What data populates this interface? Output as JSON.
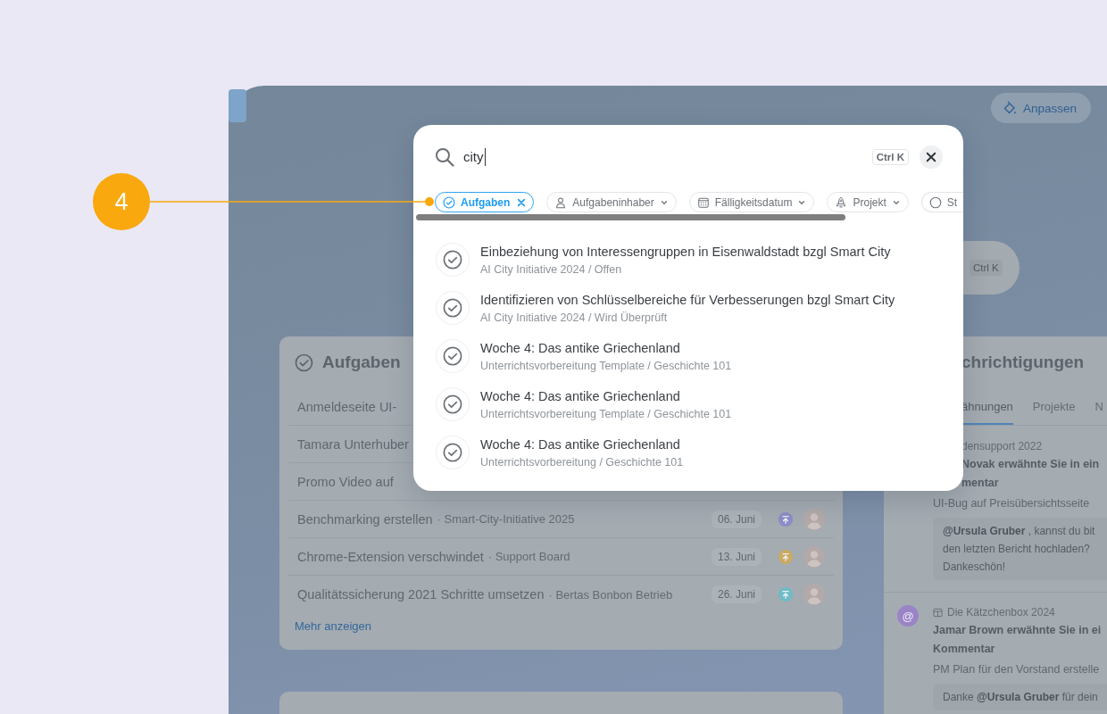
{
  "callout": {
    "number": "4"
  },
  "dashboard": {
    "customize_button": {
      "label": "Anpassen"
    },
    "search_bar": {
      "shortcut": "Ctrl K"
    },
    "tasks_card": {
      "title": "Aufgaben",
      "rows": [
        {
          "title": "Anmeldeseite UI-"
        },
        {
          "title": "Tamara Unterhuber"
        },
        {
          "title": "Promo Video auf"
        },
        {
          "title": "Benchmarking erstellen",
          "project": "· Smart-City-Initiative 2025",
          "due": "06. Juni",
          "color": "#8e8cc9",
          "assignee_photo": true
        },
        {
          "title": "Chrome-Extension verschwindet",
          "project": "· Support Board",
          "due": "13. Juni",
          "color": "#c9ab63",
          "assignee_photo": true
        },
        {
          "title": "Qualitätssicherung 2021 Schritte umsetzen",
          "project": "· Bertas Bonbon Betrieb",
          "due": "26. Juni",
          "color": "#6dbcc7",
          "assignee_photo": true
        }
      ],
      "more_link": "Mehr anzeigen"
    },
    "notifications_card": {
      "title": "chrichtigungen",
      "tabs": [
        {
          "label": "ähnungen",
          "selected": true
        },
        {
          "label": "Projekte",
          "selected": false
        },
        {
          "label": "N",
          "selected": false
        }
      ],
      "items": [
        {
          "project": "densupport 2022",
          "headline": [
            "Novak erwähnte Sie in ein",
            "mentar"
          ],
          "task": "UI-Bug auf Preisübersichtsseite",
          "comment": [
            "**@Ursula Gruber** , kannst du bit",
            "den letzten Bericht hochladen?",
            "Dankeschön!"
          ]
        },
        {
          "avatar": "@",
          "project": "Die Kätzchenbox 2024",
          "headline": [
            "Jamar Brown erwähnte Sie in ei",
            "Kommentar"
          ],
          "task": "PM Plan für den Vorstand erstelle",
          "comment": [
            "Danke **@Ursula Gruber** für dein"
          ]
        }
      ]
    }
  },
  "search_dialog": {
    "query": "city",
    "shortcut": "Ctrl K",
    "filters": [
      {
        "kind": "type",
        "label": "Aufgaben",
        "selected": true
      },
      {
        "kind": "assignee",
        "label": "Aufgabeninhaber",
        "selected": false
      },
      {
        "kind": "due_date",
        "label": "Fälligkeitsdatum",
        "selected": false
      },
      {
        "kind": "project",
        "label": "Projekt",
        "selected": false
      },
      {
        "kind": "status",
        "label": "St",
        "selected": false
      }
    ],
    "results": [
      {
        "title": "Einbeziehung von Interessengruppen in Eisenwaldstadt bzgl Smart City",
        "subtitle": "AI City Initiative 2024 / Offen"
      },
      {
        "title": "Identifizieren von Schlüsselbereiche für Verbesserungen bzgl Smart City",
        "subtitle": "AI City Initiative 2024 / Wird Überprüft"
      },
      {
        "title": "Woche 4: Das antike Griechenland",
        "subtitle": "Unterrichtsvorbereitung Template / Geschichte 101"
      },
      {
        "title": "Woche 4: Das antike Griechenland",
        "subtitle": "Unterrichtsvorbereitung Template / Geschichte 101"
      },
      {
        "title": "Woche 4: Das antike Griechenland",
        "subtitle": "Unterrichtsvorbereitung / Geschichte 101"
      }
    ]
  }
}
